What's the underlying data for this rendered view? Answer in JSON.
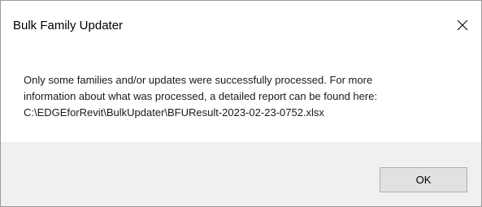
{
  "dialog": {
    "title": "Bulk Family Updater",
    "close_icon": "close-icon",
    "message_lines": [
      "Only some families and/or updates were successfully processed. For more",
      "information about what was processed, a detailed report can be found here:",
      "C:\\EDGEforRevit\\BulkUpdater\\BFUResult-2023-02-23-0752.xlsx"
    ],
    "ok_label": "OK"
  },
  "colors": {
    "footer_bg": "#f0f0f0",
    "button_bg": "#e1e1e1",
    "button_border": "#adadad"
  }
}
